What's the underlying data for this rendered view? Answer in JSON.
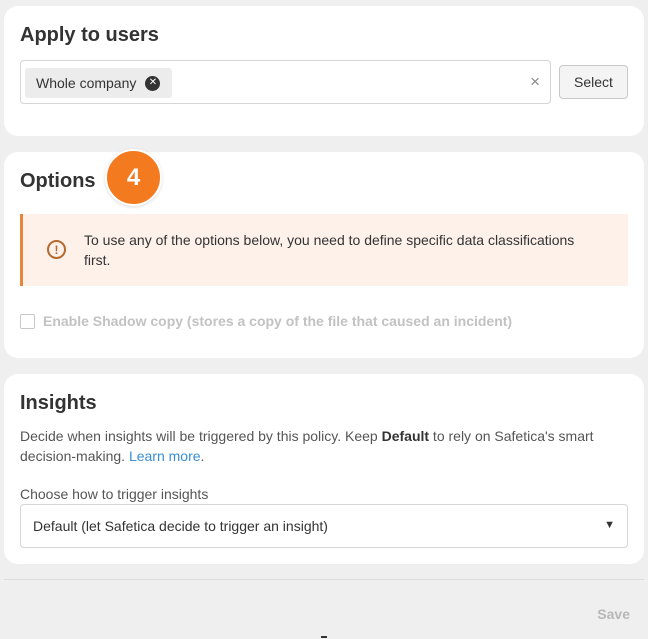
{
  "apply_to_users": {
    "title": "Apply to users",
    "chip_label": "Whole company",
    "chip_remove_icon": "x-circle-icon",
    "clear_icon": "×",
    "select_label": "Select"
  },
  "options": {
    "title": "Options",
    "step_badge": "4",
    "step_badge_color": "#f37a1f",
    "alert_icon": "!",
    "alert_text": "To use any of the options below, you need to define specific data classifications first.",
    "shadow_copy_label": "Enable Shadow copy (stores a copy of the file that caused an incident)",
    "shadow_copy_checked": false,
    "shadow_copy_disabled": true
  },
  "insights": {
    "title": "Insights",
    "desc_prefix": "Decide when insights will be triggered by this policy. Keep ",
    "desc_bold": "Default",
    "desc_suffix": " to rely on Safetica's smart decision-making. ",
    "learn_more": "Learn more",
    "desc_end": ".",
    "trigger_label": "Choose how to trigger insights",
    "trigger_value": "Default (let Safetica decide to trigger an insight)",
    "link_color": "#3a8ed4"
  },
  "footer": {
    "save_label": "Save"
  }
}
